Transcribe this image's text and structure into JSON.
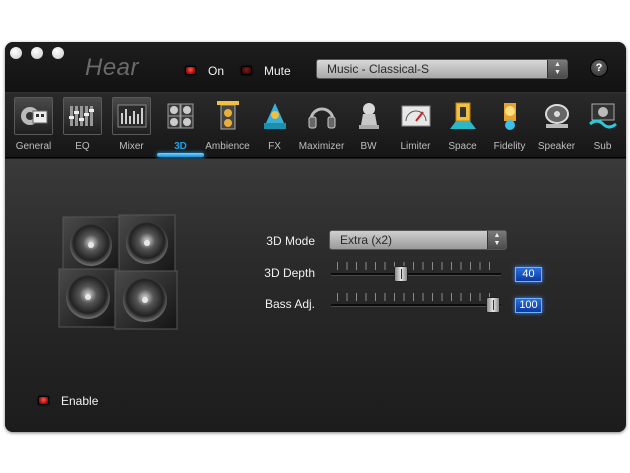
{
  "app": {
    "title": "Hear"
  },
  "header": {
    "on_label": "On",
    "mute_label": "Mute",
    "preset_value": "Music - Classical-S",
    "help_label": "?"
  },
  "tabs": [
    {
      "label": "General",
      "icon": "general-icon"
    },
    {
      "label": "EQ",
      "icon": "eq-icon"
    },
    {
      "label": "Mixer",
      "icon": "mixer-icon"
    },
    {
      "label": "3D",
      "icon": "speakers-3d-icon",
      "active": true
    },
    {
      "label": "Ambience",
      "icon": "ambience-icon"
    },
    {
      "label": "FX",
      "icon": "fx-icon"
    },
    {
      "label": "Maximizer",
      "icon": "headphones-icon"
    },
    {
      "label": "BW",
      "icon": "bw-icon"
    },
    {
      "label": "Limiter",
      "icon": "meter-icon"
    },
    {
      "label": "Space",
      "icon": "space-icon"
    },
    {
      "label": "Fidelity",
      "icon": "fidelity-icon"
    },
    {
      "label": "Speaker",
      "icon": "speaker-icon"
    },
    {
      "label": "Sub",
      "icon": "sub-icon"
    }
  ],
  "panel": {
    "mode_label": "3D Mode",
    "mode_value": "Extra (x2)",
    "depth_label": "3D Depth",
    "depth_value": "40",
    "depth_fraction": 0.4,
    "bass_label": "Bass Adj.",
    "bass_value": "100",
    "bass_fraction": 1.0,
    "enable_label": "Enable"
  },
  "colors": {
    "accent": "#1aa3e8",
    "led_on": "#e02020",
    "value_box": "#1a50c8"
  }
}
